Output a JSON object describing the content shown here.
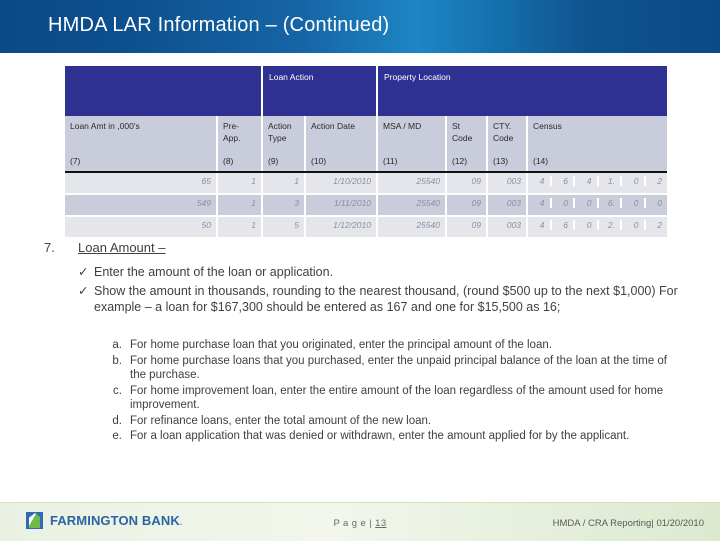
{
  "slide": {
    "title": "HMDA LAR Information – (Continued)"
  },
  "table": {
    "group_headers": [
      {
        "label": "",
        "span": "loan-amount-prepay"
      },
      {
        "label": "Loan Action",
        "span": "loan-action"
      },
      {
        "label": "Property Location",
        "span": "property-location"
      }
    ],
    "columns": [
      {
        "label": "Loan Amt  in ,000’s",
        "number": "(7)"
      },
      {
        "label": "Pre-App.",
        "number": "(8)"
      },
      {
        "label": "Action Type",
        "number": "(9)"
      },
      {
        "label": "Action Date",
        "number": "(10)"
      },
      {
        "label": "MSA / MD",
        "number": "(11)"
      },
      {
        "label": "St Code",
        "number": "(12)"
      },
      {
        "label": "CTY. Code",
        "number": "(13)"
      },
      {
        "label": "Census",
        "number": "(14)"
      }
    ],
    "rows": [
      {
        "loan_amount": "65",
        "pre_app": "1",
        "action_type": "1",
        "action_date": "1/10/2010",
        "msa_md": "25540",
        "st_code": "09",
        "cty_code": "003",
        "census": [
          "4",
          "6",
          "4",
          "1.",
          "0",
          "2"
        ]
      },
      {
        "loan_amount": "549",
        "pre_app": "1",
        "action_type": "3",
        "action_date": "1/11/2010",
        "msa_md": "25540",
        "st_code": "09",
        "cty_code": "003",
        "census": [
          "4",
          "0",
          "0",
          "6.",
          "0",
          "0"
        ]
      },
      {
        "loan_amount": "50",
        "pre_app": "1",
        "action_type": "5",
        "action_date": "1/12/2010",
        "msa_md": "25540",
        "st_code": "09",
        "cty_code": "003",
        "census": [
          "4",
          "6",
          "0",
          "2.",
          "0",
          "2"
        ]
      }
    ]
  },
  "body": {
    "item_number": "7.",
    "item_heading": "Loan Amount –",
    "checks": [
      "Enter the amount of the loan or application.",
      "Show the amount in thousands, rounding to the nearest thousand, (round $500 up to the next $1,000) For example – a loan for $167,300 should be entered as 167 and one for $15,500 as 16;"
    ],
    "check_marker": "✓",
    "alpha_items": [
      {
        "marker": "a.",
        "text": "For home purchase loan that you originated, enter the principal amount of the loan."
      },
      {
        "marker": "b.",
        "text": "For home purchase loans that you purchased, enter the unpaid principal balance of the loan at the time of the purchase."
      },
      {
        "marker": "c.",
        "text": "For home improvement loan, enter the entire amount of the loan regardless of the amount used for home improvement."
      },
      {
        "marker": "d.",
        "text": "For refinance loans, enter the total amount of the new loan."
      },
      {
        "marker": "e.",
        "text": "For a loan application that was denied or withdrawn, enter the amount applied for by the applicant."
      }
    ]
  },
  "footer": {
    "logo_text": "FARMINGTON BANK",
    "logo_suffix": ".",
    "page_label": "P a g e ",
    "page_separator": "| ",
    "page_number": "13",
    "right_info": "HMDA / CRA Reporting| 01/20/2010"
  },
  "colors": {
    "title_bar_dark": "#0a4a87",
    "title_bar_light": "#1d86c4",
    "table_group_header": "#2e3192",
    "table_header_cell": "#c9ccdb",
    "row_odd": "#e4e6ec",
    "row_even": "#c9ccdb",
    "footer_green": "#e9f1e2",
    "logo_blue": "#2b63a6",
    "logo_green": "#6fba46"
  }
}
